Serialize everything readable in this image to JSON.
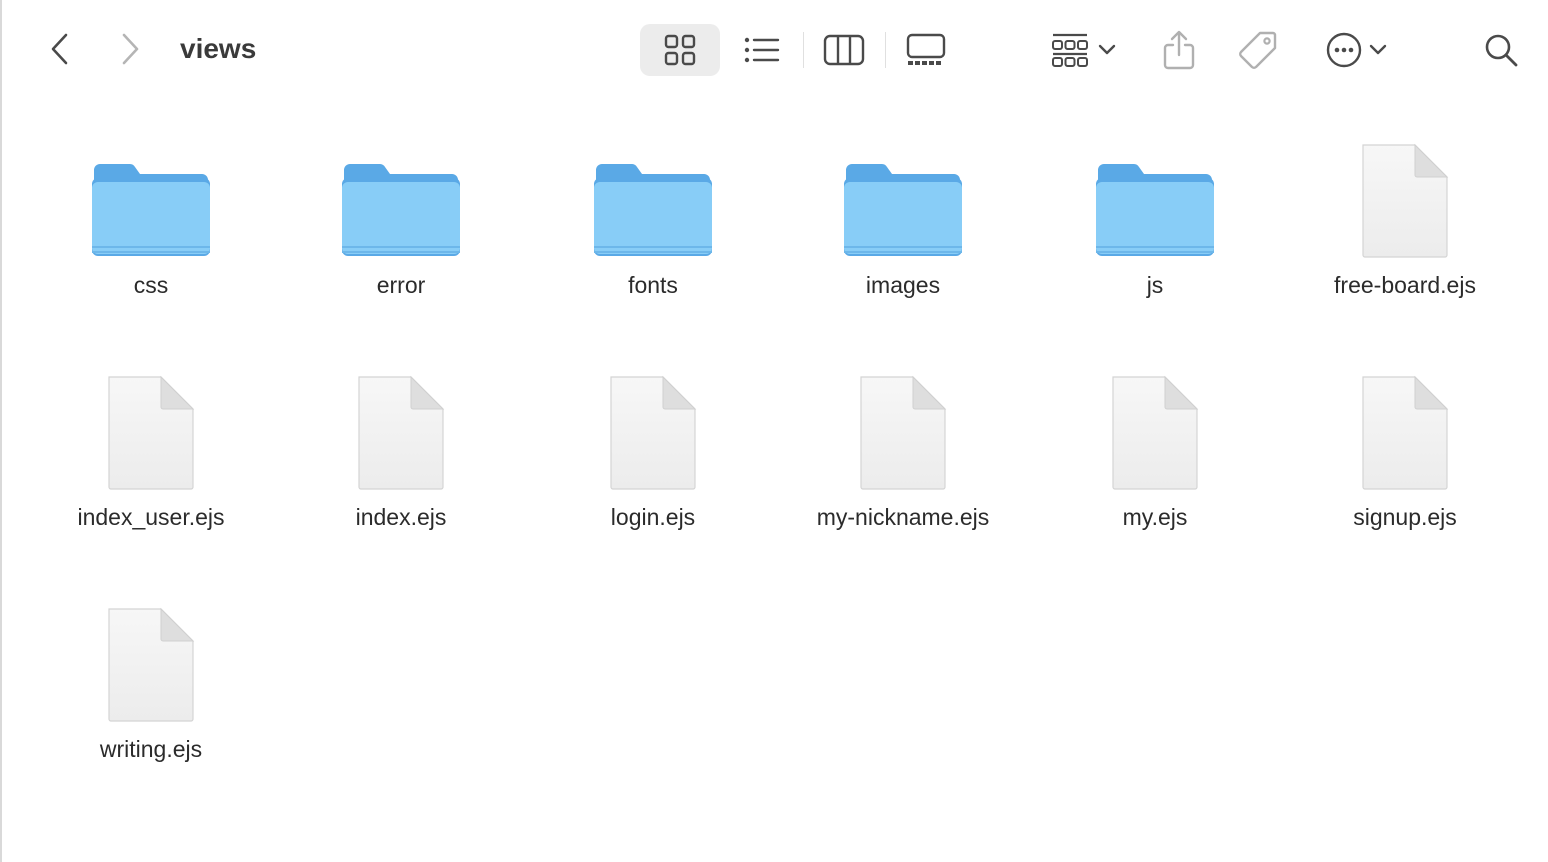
{
  "window": {
    "title": "views"
  },
  "toolbar": {
    "back_icon": "chevron-left-icon",
    "forward_icon": "chevron-right-icon",
    "view_modes": [
      "icon-view-icon",
      "list-view-icon",
      "column-view-icon",
      "gallery-view-icon"
    ],
    "active_view": "icon-view-icon",
    "group_icon": "group-grid-icon",
    "share_icon": "share-icon",
    "tag_icon": "tag-icon",
    "more_icon": "ellipsis-circle-icon",
    "search_icon": "search-icon"
  },
  "colors": {
    "folder_body": "#7cc4f4",
    "folder_tab": "#5aa9e6",
    "title_text": "#3a3a3a",
    "active_view_bg": "#ececec"
  },
  "files": [
    {
      "name": "css",
      "kind": "folder"
    },
    {
      "name": "error",
      "kind": "folder"
    },
    {
      "name": "fonts",
      "kind": "folder"
    },
    {
      "name": "images",
      "kind": "folder"
    },
    {
      "name": "js",
      "kind": "folder"
    },
    {
      "name": "free-board.ejs",
      "kind": "document"
    },
    {
      "name": "index_user.ejs",
      "kind": "document"
    },
    {
      "name": "index.ejs",
      "kind": "document"
    },
    {
      "name": "login.ejs",
      "kind": "document"
    },
    {
      "name": "my-nickname.ejs",
      "kind": "document"
    },
    {
      "name": "my.ejs",
      "kind": "document"
    },
    {
      "name": "signup.ejs",
      "kind": "document"
    },
    {
      "name": "writing.ejs",
      "kind": "document"
    }
  ]
}
